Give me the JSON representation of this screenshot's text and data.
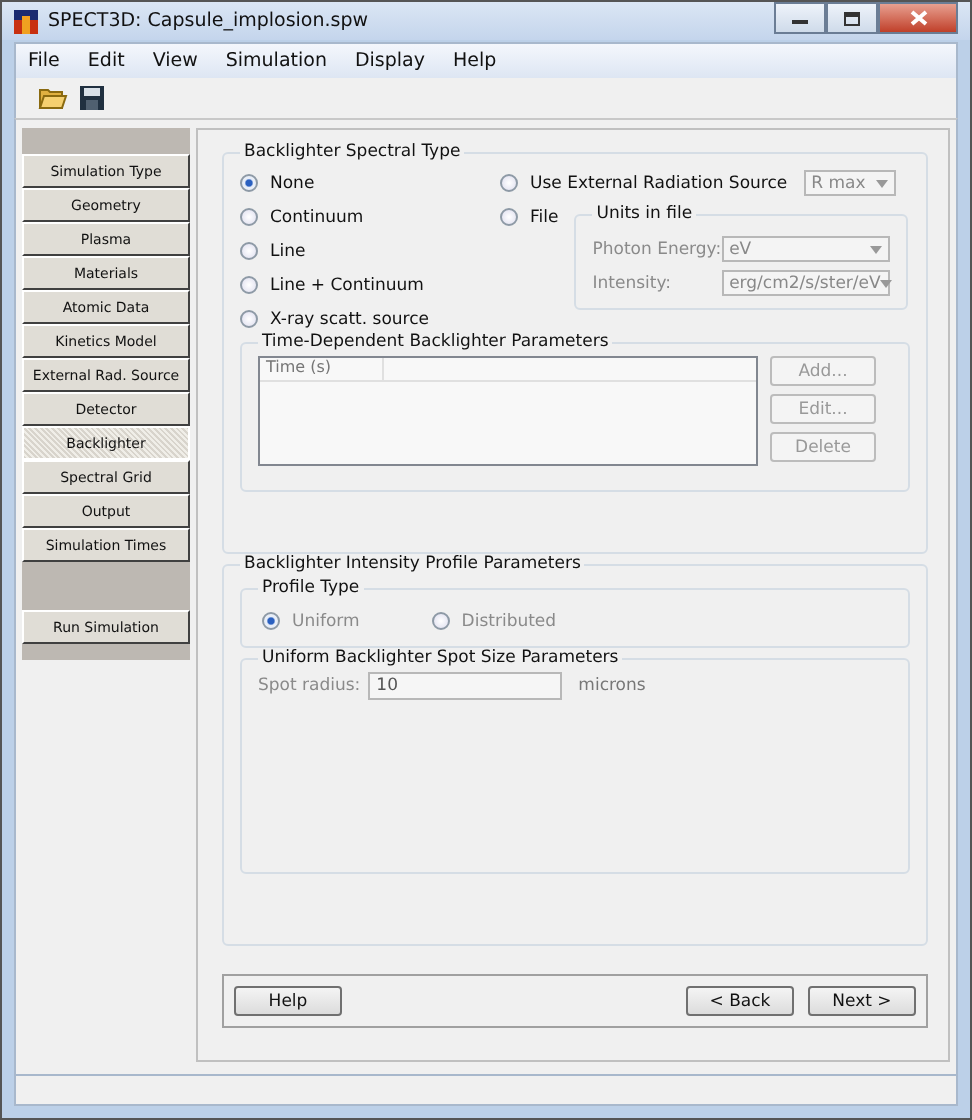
{
  "window": {
    "title": "SPECT3D:  Capsule_implosion.spw"
  },
  "menu": [
    "File",
    "Edit",
    "View",
    "Simulation",
    "Display",
    "Help"
  ],
  "sidebar": {
    "items": [
      {
        "label": "Simulation Type",
        "selected": false
      },
      {
        "label": "Geometry",
        "selected": false
      },
      {
        "label": "Plasma",
        "selected": false
      },
      {
        "label": "Materials",
        "selected": false
      },
      {
        "label": "Atomic Data",
        "selected": false
      },
      {
        "label": "Kinetics Model",
        "selected": false
      },
      {
        "label": "External Rad. Source",
        "selected": false
      },
      {
        "label": "Detector",
        "selected": false
      },
      {
        "label": "Backlighter",
        "selected": true
      },
      {
        "label": "Spectral Grid",
        "selected": false
      },
      {
        "label": "Output",
        "selected": false
      },
      {
        "label": "Simulation Times",
        "selected": false
      }
    ],
    "run_button": "Run Simulation"
  },
  "spectral_type": {
    "title": "Backlighter Spectral Type",
    "options": [
      {
        "label": "None",
        "selected": true
      },
      {
        "label": "Continuum",
        "selected": false
      },
      {
        "label": "Line",
        "selected": false
      },
      {
        "label": "Line + Continuum",
        "selected": false
      },
      {
        "label": "X-ray scatt. source",
        "selected": false
      }
    ],
    "external": {
      "label": "Use External Radiation Source",
      "selected": false,
      "dropdown": "R max",
      "disabled": true
    },
    "file": {
      "label": "File",
      "selected": false
    },
    "units_in_file": {
      "title": "Units in file",
      "disabled": true,
      "fields": [
        {
          "label": "Photon Energy:",
          "value": "eV"
        },
        {
          "label": "Intensity:",
          "value": "erg/cm2/s/ster/eV"
        }
      ]
    }
  },
  "time_dependent": {
    "title": "Time-Dependent Backlighter Parameters",
    "columns": [
      "Time (s)"
    ],
    "buttons": [
      {
        "label": "Add...",
        "disabled": true
      },
      {
        "label": "Edit...",
        "disabled": true
      },
      {
        "label": "Delete",
        "disabled": true
      }
    ]
  },
  "intensity_profile": {
    "title": "Backlighter Intensity Profile Parameters",
    "profile_type": {
      "title": "Profile Type",
      "options": [
        {
          "label": "Uniform",
          "selected": true,
          "disabled": true
        },
        {
          "label": "Distributed",
          "selected": false,
          "disabled": true
        }
      ]
    },
    "spot_size": {
      "title": "Uniform Backlighter Spot Size Parameters",
      "label": "Spot radius:",
      "value": "10",
      "unit": "microns",
      "disabled": true
    }
  },
  "footer": {
    "help": "Help",
    "back": "< Back",
    "next": "Next >"
  }
}
